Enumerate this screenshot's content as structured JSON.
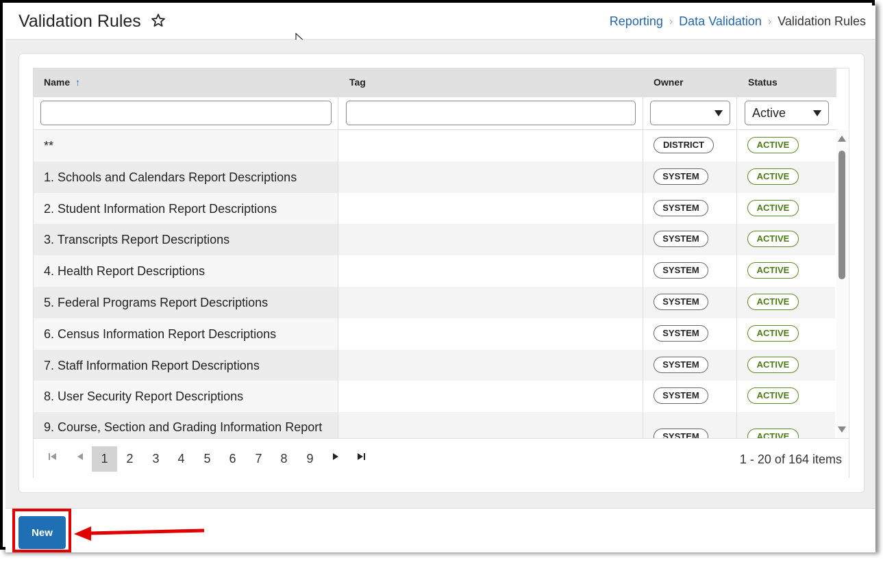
{
  "header": {
    "title": "Validation Rules",
    "favorite_icon": "star-outline-icon",
    "breadcrumbs": [
      {
        "label": "Reporting",
        "link": true
      },
      {
        "label": "Data Validation",
        "link": true
      },
      {
        "label": "Validation Rules",
        "link": false
      }
    ]
  },
  "grid": {
    "columns": [
      {
        "label": "Name",
        "sort": "ascending"
      },
      {
        "label": "Tag"
      },
      {
        "label": "Owner"
      },
      {
        "label": "Status"
      }
    ],
    "filters": {
      "name": "",
      "tag": "",
      "owner": "",
      "status": "Active"
    },
    "rows": [
      {
        "name": "**",
        "tag": "",
        "owner": "DISTRICT",
        "status": "ACTIVE"
      },
      {
        "name": "1. Schools and Calendars Report Descriptions",
        "tag": "",
        "owner": "SYSTEM",
        "status": "ACTIVE"
      },
      {
        "name": "2. Student Information Report Descriptions",
        "tag": "",
        "owner": "SYSTEM",
        "status": "ACTIVE"
      },
      {
        "name": "3. Transcripts Report Descriptions",
        "tag": "",
        "owner": "SYSTEM",
        "status": "ACTIVE"
      },
      {
        "name": "4. Health Report Descriptions",
        "tag": "",
        "owner": "SYSTEM",
        "status": "ACTIVE"
      },
      {
        "name": "5. Federal Programs Report Descriptions",
        "tag": "",
        "owner": "SYSTEM",
        "status": "ACTIVE"
      },
      {
        "name": "6. Census Information Report Descriptions",
        "tag": "",
        "owner": "SYSTEM",
        "status": "ACTIVE"
      },
      {
        "name": "7. Staff Information Report Descriptions",
        "tag": "",
        "owner": "SYSTEM",
        "status": "ACTIVE"
      },
      {
        "name": "8. User Security Report Descriptions",
        "tag": "",
        "owner": "SYSTEM",
        "status": "ACTIVE"
      },
      {
        "name": "9. Course, Section and Grading Information Report",
        "tag": "",
        "owner": "SYSTEM",
        "status": "ACTIVE"
      }
    ],
    "pager": {
      "pages": [
        "1",
        "2",
        "3",
        "4",
        "5",
        "6",
        "7",
        "8",
        "9"
      ],
      "current_page": "1",
      "info": "1 - 20 of 164 items"
    }
  },
  "footer": {
    "new_label": "New"
  },
  "colors": {
    "accent": "#1f6fb5",
    "status_active": "#4b7b16",
    "annotation": "#e00000"
  }
}
